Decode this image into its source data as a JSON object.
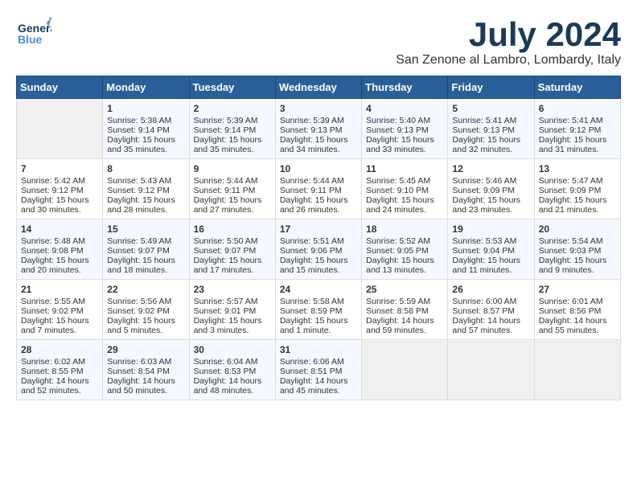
{
  "header": {
    "logo_general": "General",
    "logo_blue": "Blue",
    "month_title": "July 2024",
    "location": "San Zenone al Lambro, Lombardy, Italy"
  },
  "weekdays": [
    "Sunday",
    "Monday",
    "Tuesday",
    "Wednesday",
    "Thursday",
    "Friday",
    "Saturday"
  ],
  "weeks": [
    [
      {
        "day": "",
        "empty": true
      },
      {
        "day": "1",
        "sunrise": "Sunrise: 5:38 AM",
        "sunset": "Sunset: 9:14 PM",
        "daylight": "Daylight: 15 hours and 35 minutes."
      },
      {
        "day": "2",
        "sunrise": "Sunrise: 5:39 AM",
        "sunset": "Sunset: 9:14 PM",
        "daylight": "Daylight: 15 hours and 35 minutes."
      },
      {
        "day": "3",
        "sunrise": "Sunrise: 5:39 AM",
        "sunset": "Sunset: 9:13 PM",
        "daylight": "Daylight: 15 hours and 34 minutes."
      },
      {
        "day": "4",
        "sunrise": "Sunrise: 5:40 AM",
        "sunset": "Sunset: 9:13 PM",
        "daylight": "Daylight: 15 hours and 33 minutes."
      },
      {
        "day": "5",
        "sunrise": "Sunrise: 5:41 AM",
        "sunset": "Sunset: 9:13 PM",
        "daylight": "Daylight: 15 hours and 32 minutes."
      },
      {
        "day": "6",
        "sunrise": "Sunrise: 5:41 AM",
        "sunset": "Sunset: 9:12 PM",
        "daylight": "Daylight: 15 hours and 31 minutes."
      }
    ],
    [
      {
        "day": "7",
        "sunrise": "Sunrise: 5:42 AM",
        "sunset": "Sunset: 9:12 PM",
        "daylight": "Daylight: 15 hours and 30 minutes."
      },
      {
        "day": "8",
        "sunrise": "Sunrise: 5:43 AM",
        "sunset": "Sunset: 9:12 PM",
        "daylight": "Daylight: 15 hours and 28 minutes."
      },
      {
        "day": "9",
        "sunrise": "Sunrise: 5:44 AM",
        "sunset": "Sunset: 9:11 PM",
        "daylight": "Daylight: 15 hours and 27 minutes."
      },
      {
        "day": "10",
        "sunrise": "Sunrise: 5:44 AM",
        "sunset": "Sunset: 9:11 PM",
        "daylight": "Daylight: 15 hours and 26 minutes."
      },
      {
        "day": "11",
        "sunrise": "Sunrise: 5:45 AM",
        "sunset": "Sunset: 9:10 PM",
        "daylight": "Daylight: 15 hours and 24 minutes."
      },
      {
        "day": "12",
        "sunrise": "Sunrise: 5:46 AM",
        "sunset": "Sunset: 9:09 PM",
        "daylight": "Daylight: 15 hours and 23 minutes."
      },
      {
        "day": "13",
        "sunrise": "Sunrise: 5:47 AM",
        "sunset": "Sunset: 9:09 PM",
        "daylight": "Daylight: 15 hours and 21 minutes."
      }
    ],
    [
      {
        "day": "14",
        "sunrise": "Sunrise: 5:48 AM",
        "sunset": "Sunset: 9:08 PM",
        "daylight": "Daylight: 15 hours and 20 minutes."
      },
      {
        "day": "15",
        "sunrise": "Sunrise: 5:49 AM",
        "sunset": "Sunset: 9:07 PM",
        "daylight": "Daylight: 15 hours and 18 minutes."
      },
      {
        "day": "16",
        "sunrise": "Sunrise: 5:50 AM",
        "sunset": "Sunset: 9:07 PM",
        "daylight": "Daylight: 15 hours and 17 minutes."
      },
      {
        "day": "17",
        "sunrise": "Sunrise: 5:51 AM",
        "sunset": "Sunset: 9:06 PM",
        "daylight": "Daylight: 15 hours and 15 minutes."
      },
      {
        "day": "18",
        "sunrise": "Sunrise: 5:52 AM",
        "sunset": "Sunset: 9:05 PM",
        "daylight": "Daylight: 15 hours and 13 minutes."
      },
      {
        "day": "19",
        "sunrise": "Sunrise: 5:53 AM",
        "sunset": "Sunset: 9:04 PM",
        "daylight": "Daylight: 15 hours and 11 minutes."
      },
      {
        "day": "20",
        "sunrise": "Sunrise: 5:54 AM",
        "sunset": "Sunset: 9:03 PM",
        "daylight": "Daylight: 15 hours and 9 minutes."
      }
    ],
    [
      {
        "day": "21",
        "sunrise": "Sunrise: 5:55 AM",
        "sunset": "Sunset: 9:02 PM",
        "daylight": "Daylight: 15 hours and 7 minutes."
      },
      {
        "day": "22",
        "sunrise": "Sunrise: 5:56 AM",
        "sunset": "Sunset: 9:02 PM",
        "daylight": "Daylight: 15 hours and 5 minutes."
      },
      {
        "day": "23",
        "sunrise": "Sunrise: 5:57 AM",
        "sunset": "Sunset: 9:01 PM",
        "daylight": "Daylight: 15 hours and 3 minutes."
      },
      {
        "day": "24",
        "sunrise": "Sunrise: 5:58 AM",
        "sunset": "Sunset: 8:59 PM",
        "daylight": "Daylight: 15 hours and 1 minute."
      },
      {
        "day": "25",
        "sunrise": "Sunrise: 5:59 AM",
        "sunset": "Sunset: 8:58 PM",
        "daylight": "Daylight: 14 hours and 59 minutes."
      },
      {
        "day": "26",
        "sunrise": "Sunrise: 6:00 AM",
        "sunset": "Sunset: 8:57 PM",
        "daylight": "Daylight: 14 hours and 57 minutes."
      },
      {
        "day": "27",
        "sunrise": "Sunrise: 6:01 AM",
        "sunset": "Sunset: 8:56 PM",
        "daylight": "Daylight: 14 hours and 55 minutes."
      }
    ],
    [
      {
        "day": "28",
        "sunrise": "Sunrise: 6:02 AM",
        "sunset": "Sunset: 8:55 PM",
        "daylight": "Daylight: 14 hours and 52 minutes."
      },
      {
        "day": "29",
        "sunrise": "Sunrise: 6:03 AM",
        "sunset": "Sunset: 8:54 PM",
        "daylight": "Daylight: 14 hours and 50 minutes."
      },
      {
        "day": "30",
        "sunrise": "Sunrise: 6:04 AM",
        "sunset": "Sunset: 8:53 PM",
        "daylight": "Daylight: 14 hours and 48 minutes."
      },
      {
        "day": "31",
        "sunrise": "Sunrise: 6:06 AM",
        "sunset": "Sunset: 8:51 PM",
        "daylight": "Daylight: 14 hours and 45 minutes."
      },
      {
        "day": "",
        "empty": true
      },
      {
        "day": "",
        "empty": true
      },
      {
        "day": "",
        "empty": true
      }
    ]
  ]
}
